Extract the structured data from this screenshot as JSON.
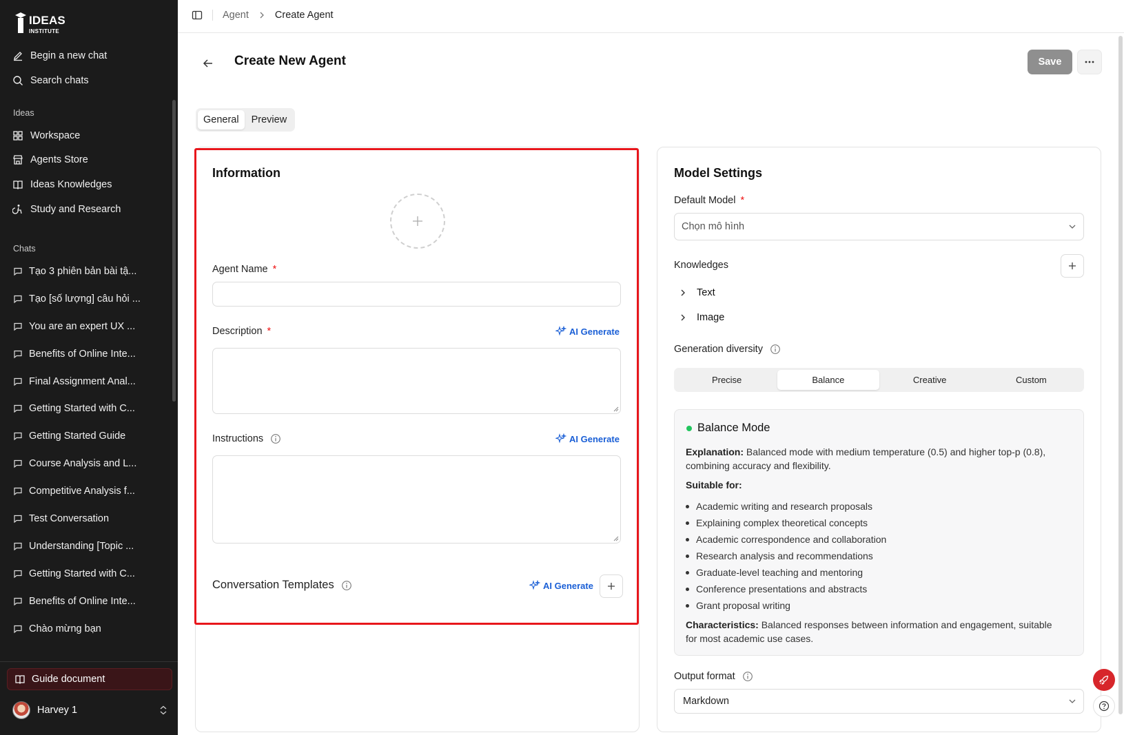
{
  "brand": {
    "name": "IDEAS",
    "sub": "INSTITUTE"
  },
  "sidebar": {
    "top_items": [
      {
        "label": "Begin a new chat",
        "icon": "pencil-icon"
      },
      {
        "label": "Search chats",
        "icon": "search-icon"
      }
    ],
    "ideas_section": "Ideas",
    "ideas_items": [
      {
        "label": "Workspace",
        "icon": "grid-icon"
      },
      {
        "label": "Agents Store",
        "icon": "store-icon"
      },
      {
        "label": "Ideas Knowledges",
        "icon": "book-icon"
      },
      {
        "label": "Study and Research",
        "icon": "accessibility-icon"
      }
    ],
    "chats_section": "Chats",
    "chats": [
      "Tạo 3 phiên bản bài tậ...",
      "Tạo [số lượng] câu hỏi ...",
      "You are an expert UX ...",
      "Benefits of Online Inte...",
      "Final Assignment Anal...",
      "Getting Started with C...",
      "Getting Started Guide",
      "Course Analysis and L...",
      "Competitive Analysis f...",
      "Test Conversation",
      "Understanding [Topic ...",
      "Getting Started with C...",
      "Benefits of Online Inte...",
      "Chào mừng bạn"
    ],
    "guide_label": "Guide document",
    "user_name": "Harvey 1"
  },
  "breadcrumb": {
    "parent": "Agent",
    "current": "Create Agent"
  },
  "header": {
    "title": "Create New Agent",
    "save_label": "Save"
  },
  "tabs": [
    "General",
    "Preview"
  ],
  "info": {
    "title": "Information",
    "agent_name_label": "Agent Name",
    "description_label": "Description",
    "instructions_label": "Instructions",
    "templates_label": "Conversation Templates",
    "ai_generate": "AI Generate",
    "required_mark": "*"
  },
  "model": {
    "title": "Model Settings",
    "default_model_label": "Default Model",
    "default_model_placeholder": "Chọn mô hình",
    "knowledges_label": "Knowledges",
    "knowledge_items": [
      "Text",
      "Image"
    ],
    "diversity_label": "Generation diversity",
    "diversity_options": [
      "Precise",
      "Balance",
      "Creative",
      "Custom"
    ],
    "diversity_selected": "Balance",
    "mode_title": "Balance Mode",
    "explanation_label": "Explanation:",
    "explanation_line1": "Balanced mode with medium temperature (0.5) and higher top-p (0.8),",
    "explanation_line2": "combining accuracy and flexibility.",
    "suitable_label": "Suitable for:",
    "suitable_items": [
      "Academic writing and research proposals",
      "Explaining complex theoretical concepts",
      "Academic correspondence and collaboration",
      "Research analysis and recommendations",
      "Graduate-level teaching and mentoring",
      "Conference presentations and abstracts",
      "Grant proposal writing"
    ],
    "characteristics_label": "Characteristics:",
    "characteristics_line1": "Balanced responses between information and engagement, suitable",
    "characteristics_line2": "for most academic use cases.",
    "output_format_label": "Output format",
    "output_format_value": "Markdown"
  },
  "colors": {
    "sidebar_bg": "#1b1b1b",
    "accent_blue": "#1a5fd6",
    "highlight_red": "#e8161c",
    "status_green": "#22c55e"
  }
}
